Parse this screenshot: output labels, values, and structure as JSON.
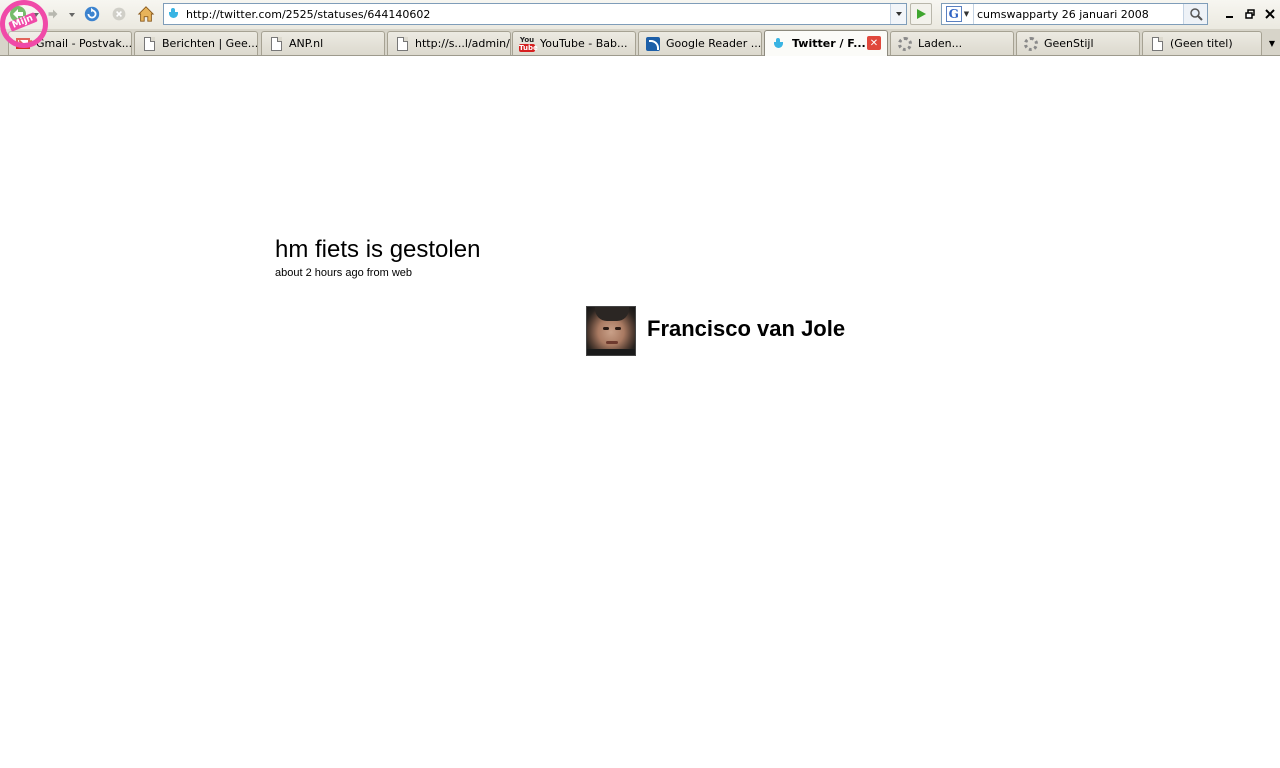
{
  "browser": {
    "url": "http://twitter.com/2525/statuses/644140602",
    "search_query": "cumswapparty 26 januari 2008",
    "search_engine_letter": "G",
    "badge_text": "Mijn"
  },
  "tabs": [
    {
      "label": "Gmail - Postvak...",
      "icon": "gmail-icon",
      "active": false
    },
    {
      "label": "Berichten | Gee...",
      "icon": "document-icon",
      "active": false
    },
    {
      "label": "ANP.nl",
      "icon": "document-icon",
      "active": false
    },
    {
      "label": "http://s...l/admin/",
      "icon": "document-icon",
      "active": false
    },
    {
      "label": "YouTube - Bab...",
      "icon": "youtube-icon",
      "active": false
    },
    {
      "label": "Google Reader ...",
      "icon": "rss-icon",
      "active": false
    },
    {
      "label": "Twitter / F...",
      "icon": "twitter-bird-icon",
      "active": true
    },
    {
      "label": "Laden...",
      "icon": "loading-spinner-icon",
      "active": false
    },
    {
      "label": "GeenStijl",
      "icon": "loading-spinner-icon",
      "active": false
    },
    {
      "label": "(Geen titel)",
      "icon": "document-icon",
      "active": false
    }
  ],
  "status": {
    "text": "hm fiets is gestolen",
    "time": "about 2 hours ago",
    "via_prefix": "from",
    "source": "web"
  },
  "author": {
    "name": "Francisco van Jole"
  },
  "colors": {
    "tab_strip": "#d7d4c9",
    "toolbar": "#ebe9e0",
    "badge": "#f04aa8",
    "twitter_blue": "#39b4e3"
  }
}
